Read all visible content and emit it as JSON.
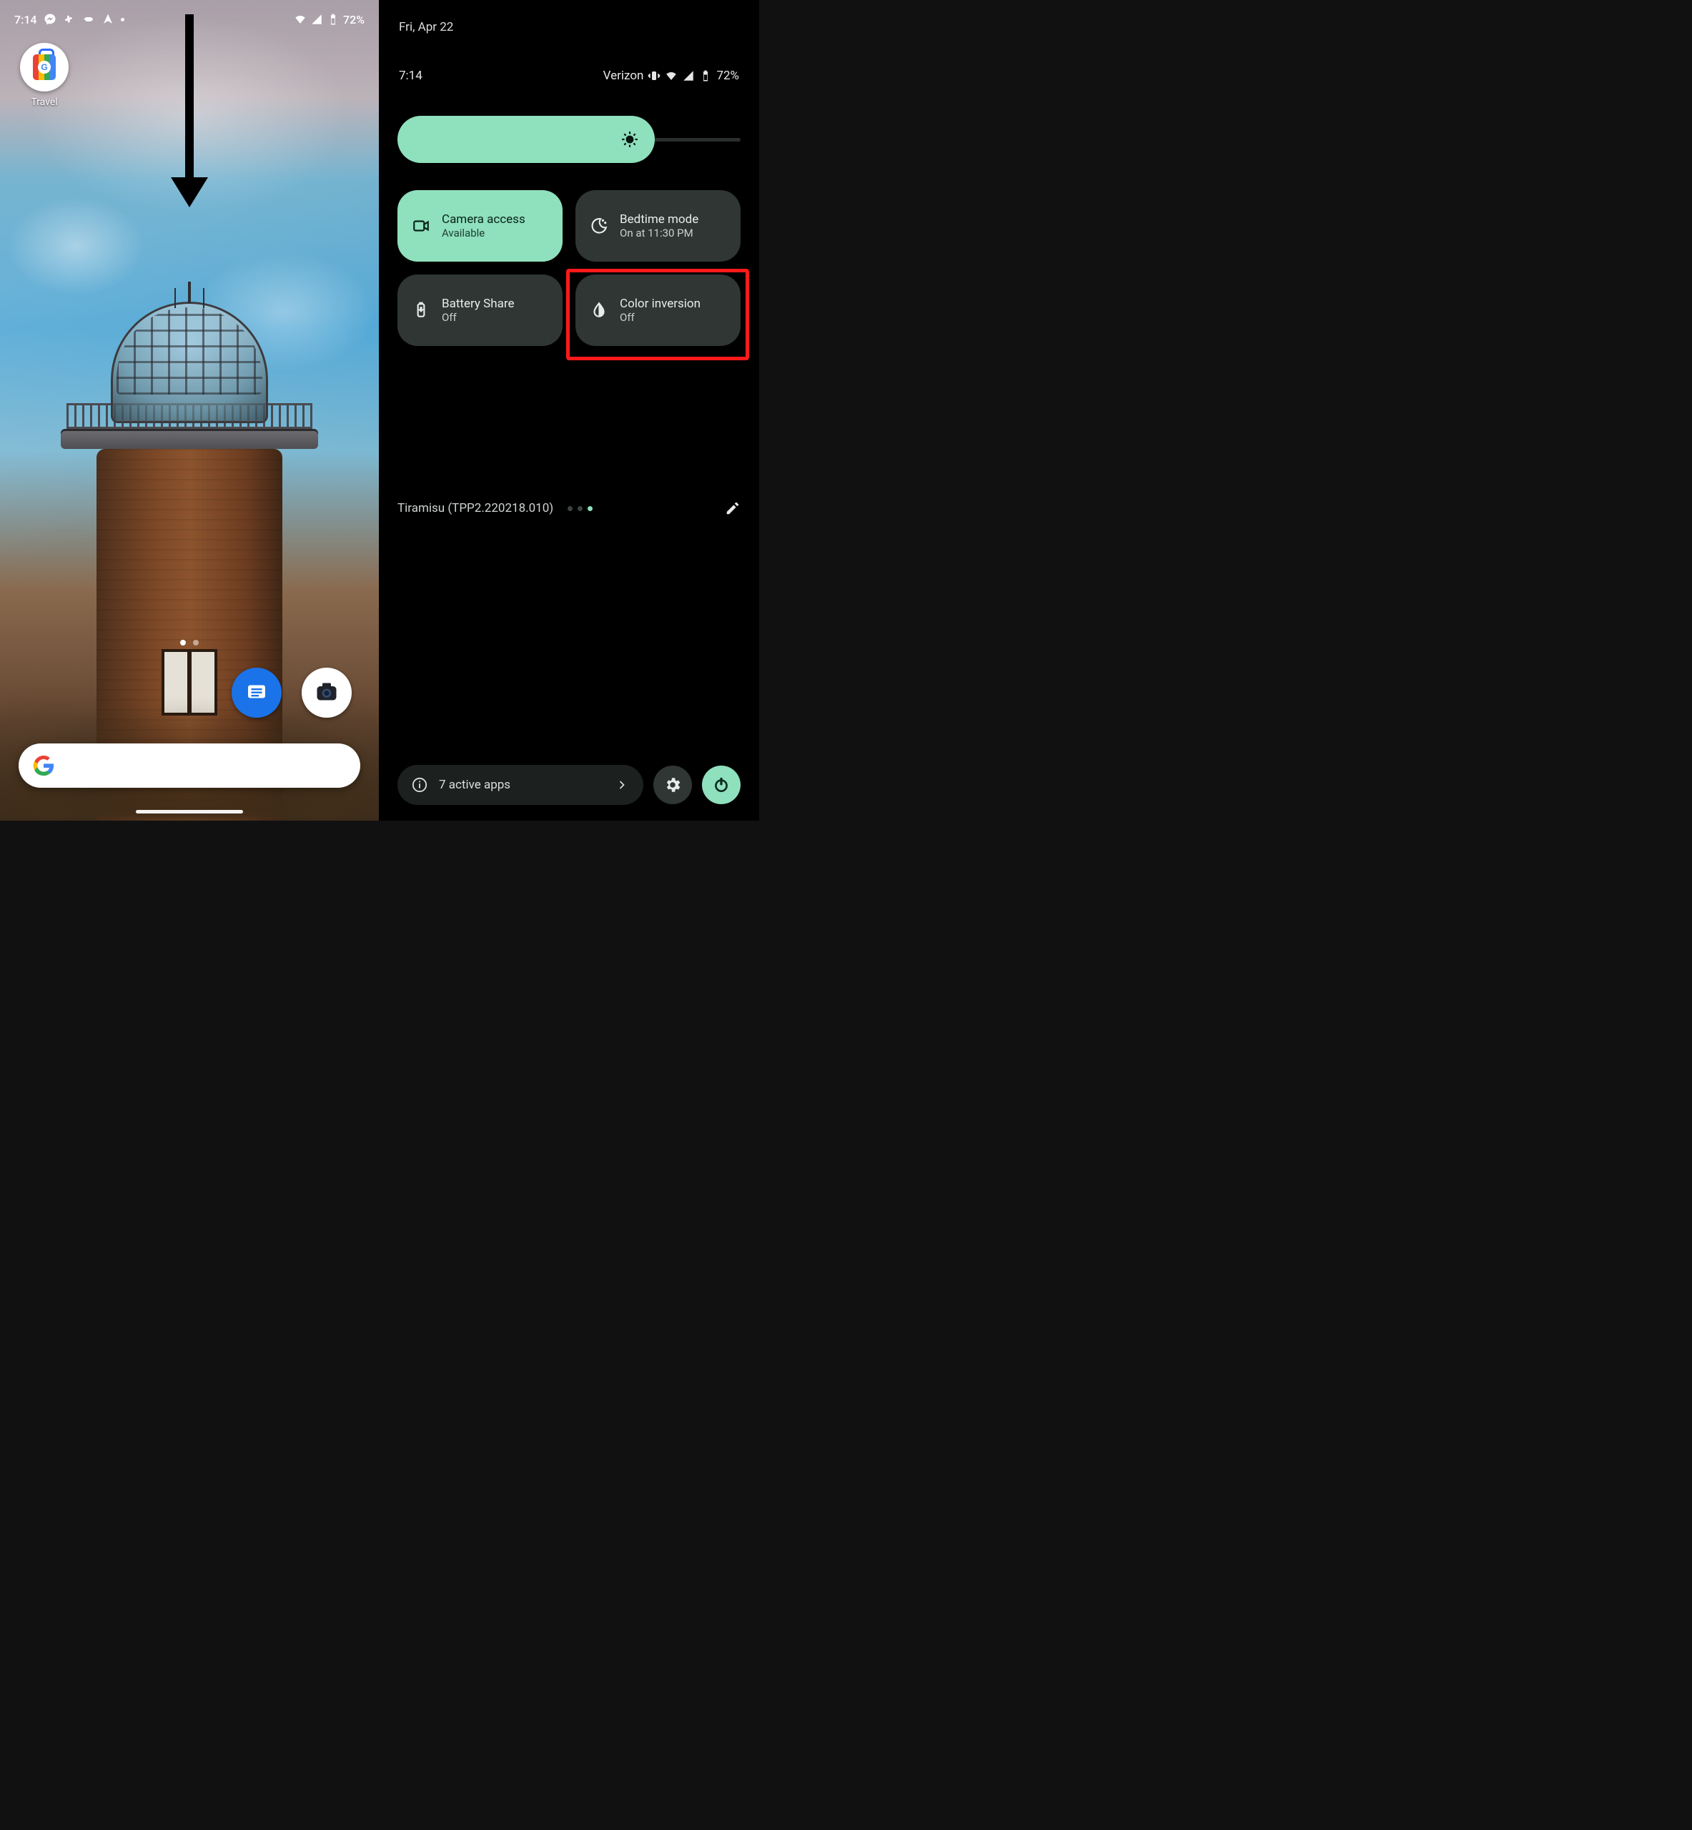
{
  "left": {
    "status": {
      "time": "7:14",
      "battery": "72%"
    },
    "app": {
      "label": "Travel"
    }
  },
  "right": {
    "date": "Fri, Apr 22",
    "status": {
      "time": "7:14",
      "carrier": "Verizon",
      "battery": "72%"
    },
    "tiles": [
      {
        "title": "Camera access",
        "subtitle": "Available"
      },
      {
        "title": "Bedtime mode",
        "subtitle": "On at 11:30 PM"
      },
      {
        "title": "Battery Share",
        "subtitle": "Off"
      },
      {
        "title": "Color inversion",
        "subtitle": "Off"
      }
    ],
    "build": "Tiramisu (TPP2.220218.010)",
    "footer": {
      "active_apps": "7 active apps"
    }
  }
}
